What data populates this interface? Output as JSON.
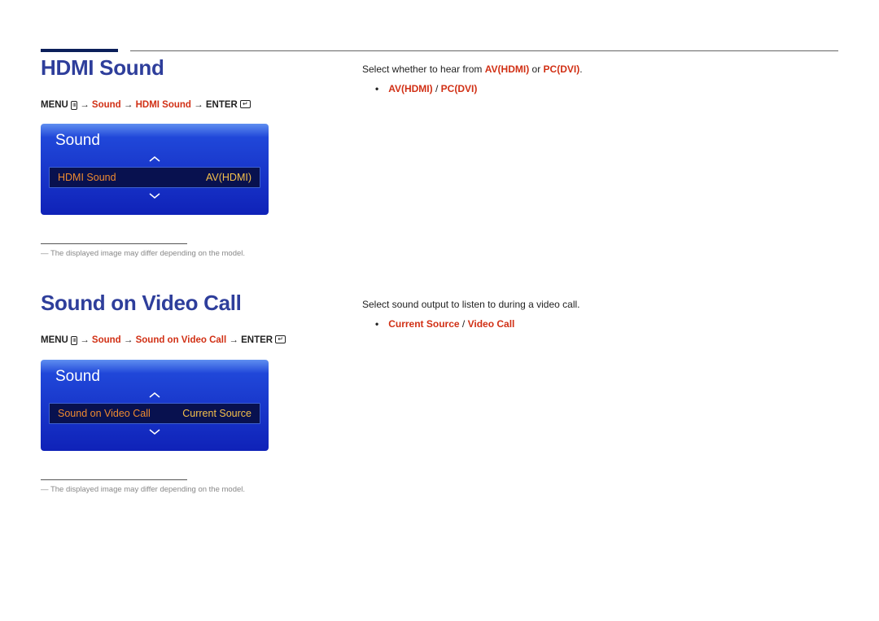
{
  "section1": {
    "title": "HDMI Sound",
    "bc_menu": "MENU",
    "bc_sound": "Sound",
    "bc_item": "HDMI Sound",
    "bc_enter": "ENTER",
    "osd_title": "Sound",
    "osd_row_label": "HDMI Sound",
    "osd_row_value": "AV(HDMI)",
    "footnote": "The displayed image may differ depending on the model.",
    "desc_pre": "Select whether to hear from ",
    "desc_r1": "AV(HDMI)",
    "desc_mid": " or ",
    "desc_r2": "PC(DVI)",
    "desc_post": ".",
    "opt1": "AV(HDMI)",
    "opt_slash": " / ",
    "opt2": "PC(DVI)"
  },
  "section2": {
    "title": "Sound on Video Call",
    "bc_menu": "MENU",
    "bc_sound": "Sound",
    "bc_item": "Sound on Video Call",
    "bc_enter": "ENTER",
    "osd_title": "Sound",
    "osd_row_label": "Sound on Video Call",
    "osd_row_value": "Current Source",
    "footnote": "The displayed image may differ depending on the model.",
    "desc_line": "Select sound output to listen to during a video call.",
    "opt1": "Current Source",
    "opt_slash": " / ",
    "opt2": "Video Call"
  },
  "arrow": "→",
  "dash": "―"
}
